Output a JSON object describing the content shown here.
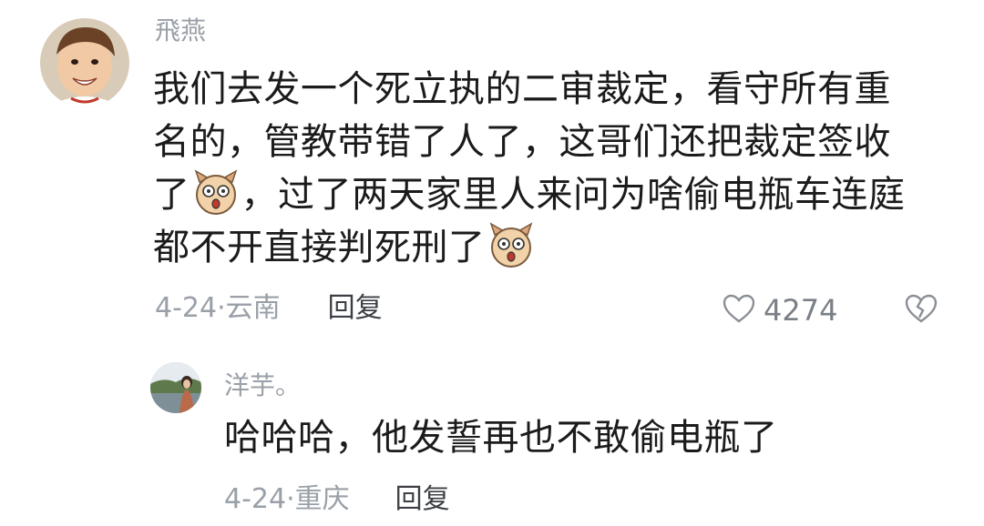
{
  "main_comment": {
    "username": "飛燕",
    "text_lines": [
      [
        "我们去发一个死立执的二审裁定，看守所有重"
      ],
      [
        "名的，管教带错了人了，这哥们还把裁定签收"
      ],
      [
        "了",
        "，过了两天家里人来问为啥偷电瓶车连庭"
      ],
      [
        "都不开直接判死刑了"
      ]
    ],
    "emoji_icon": "shocked-dog-emoji-icon",
    "date": "4-24",
    "separator": "·",
    "location": "云南",
    "reply_label": "回复",
    "like_icon": "heart-outline-icon",
    "like_count": "4274",
    "dislike_icon": "broken-heart-icon"
  },
  "reply_comment": {
    "username": "洋芋。",
    "text": "哈哈哈，他发誓再也不敢偷电瓶了",
    "date": "4-24",
    "separator": "·",
    "location": "重庆",
    "reply_label": "回复"
  },
  "colors": {
    "muted_text": "#9aa0a8",
    "body_text": "#1b1b1b",
    "background": "#ffffff"
  }
}
